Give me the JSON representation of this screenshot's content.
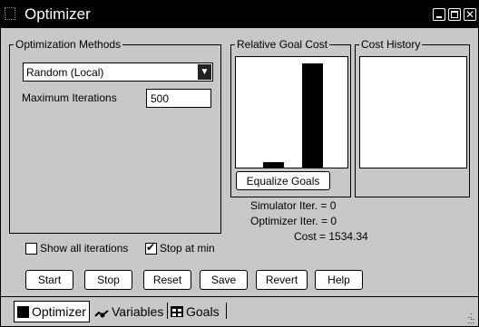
{
  "window": {
    "title": "Optimizer"
  },
  "methods": {
    "legend": "Optimization Methods",
    "selected": "Random (Local)",
    "max_iter_label": "Maximum Iterations",
    "max_iter_value": "500"
  },
  "relative_goal_cost": {
    "legend": "Relative Goal Cost",
    "bar_levels": [
      0.05,
      0.94
    ],
    "equalize_label": "Equalize Goals"
  },
  "cost_history": {
    "legend": "Cost History"
  },
  "stats": {
    "simulator_iter": "Simulator Iter. = 0",
    "optimizer_iter": "Optimizer  Iter. = 0",
    "cost": "Cost = 1534.34"
  },
  "options": {
    "show_all_label": "Show all iterations",
    "show_all_checked": false,
    "stop_at_min_label": "Stop at min",
    "stop_at_min_checked": true
  },
  "buttons": {
    "start": "Start",
    "stop": "Stop",
    "reset": "Reset",
    "save": "Save",
    "revert": "Revert",
    "help": "Help"
  },
  "tabs": [
    {
      "label": "Optimizer",
      "icon": "optimizer-icon",
      "active": true
    },
    {
      "label": "Variables",
      "icon": "variables-icon",
      "active": false
    },
    {
      "label": "Goals",
      "icon": "goals-icon",
      "active": false
    }
  ]
}
